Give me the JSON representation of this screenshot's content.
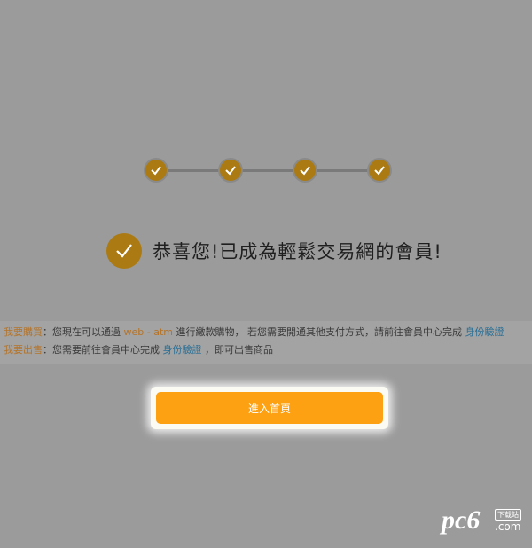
{
  "steps": [
    "check",
    "check",
    "check",
    "check"
  ],
  "colors": {
    "background": "#9b9b9b",
    "step_fill": "#ab7a12",
    "button": "#fda012",
    "label_orange": "#b4742a",
    "link_blue": "#2a6f96"
  },
  "success": {
    "icon": "check-circle-icon",
    "title": "恭喜您!已成為輕鬆交易網的會員!"
  },
  "info": {
    "buy": {
      "label": "我要購買",
      "sep": "：",
      "text1": "您現在可以通過 ",
      "highlight": "web - atm",
      "text2": " 進行繳款購物， 若您需要開通其他支付方式，請前往會員中心完成 ",
      "link": "身份驗證"
    },
    "sell": {
      "label": "我要出售",
      "sep": "：",
      "text1": "您需要前往會員中心完成 ",
      "link": "身份驗證",
      "text2": " ，即可出售商品"
    }
  },
  "button": {
    "label": "進入首頁"
  },
  "watermark": {
    "logo": "pc6",
    "tag": "下载站",
    "domain": ".com"
  }
}
